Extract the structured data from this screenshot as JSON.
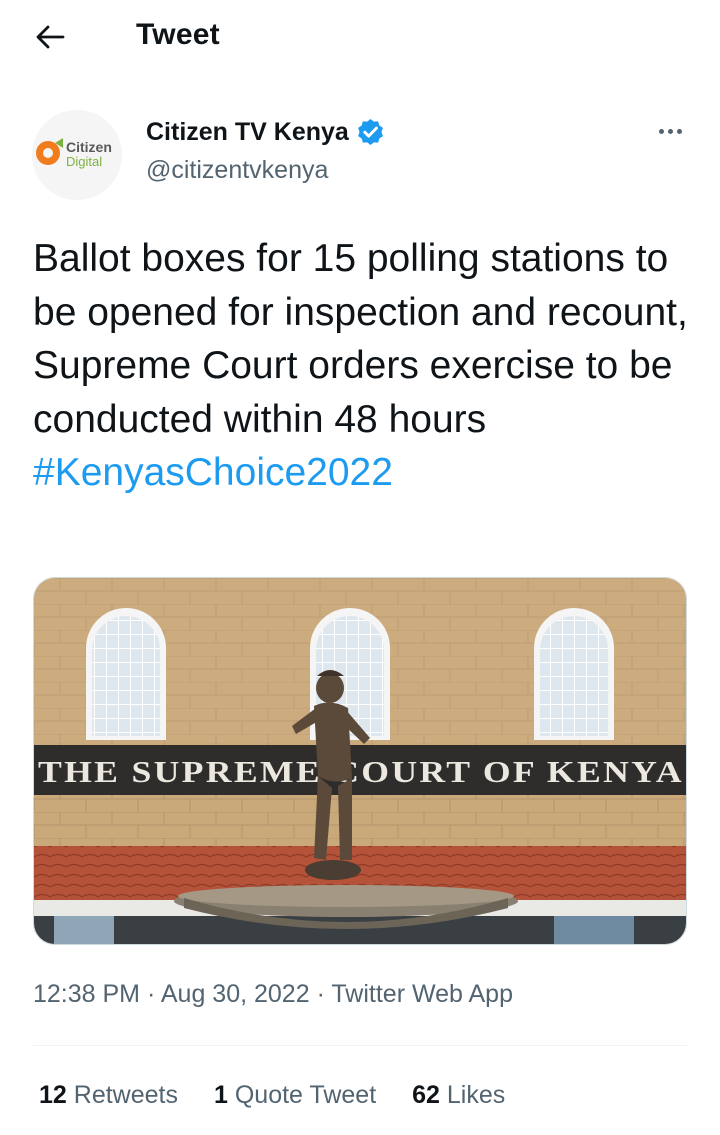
{
  "header": {
    "title": "Tweet",
    "back_icon": "arrow-left-icon"
  },
  "author": {
    "display_name": "Citizen TV Kenya",
    "handle": "@citizentvkenya",
    "verified": true,
    "avatar_text_1": "Citizen",
    "avatar_text_2": "Digital"
  },
  "tweet": {
    "text": "Ballot boxes for 15 polling stations to be opened for inspection and recount, Supreme Court orders exercise to be conducted within 48 hours",
    "hashtag": "#KenyasChoice2022",
    "image_sign": "THE SUPREME COURT OF KENYA"
  },
  "meta": {
    "time": "12:38 PM",
    "separator": "·",
    "date": "Aug 30, 2022",
    "source": "Twitter Web App"
  },
  "stats": {
    "retweets_count": "12",
    "retweets_label": "Retweets",
    "quotes_count": "1",
    "quotes_label": "Quote Tweet",
    "likes_count": "62",
    "likes_label": "Likes"
  },
  "colors": {
    "accent": "#1d9bf0",
    "text": "#0f1419",
    "secondary": "#536471",
    "avatar_orange": "#f07c1e",
    "avatar_green": "#7cb342"
  }
}
